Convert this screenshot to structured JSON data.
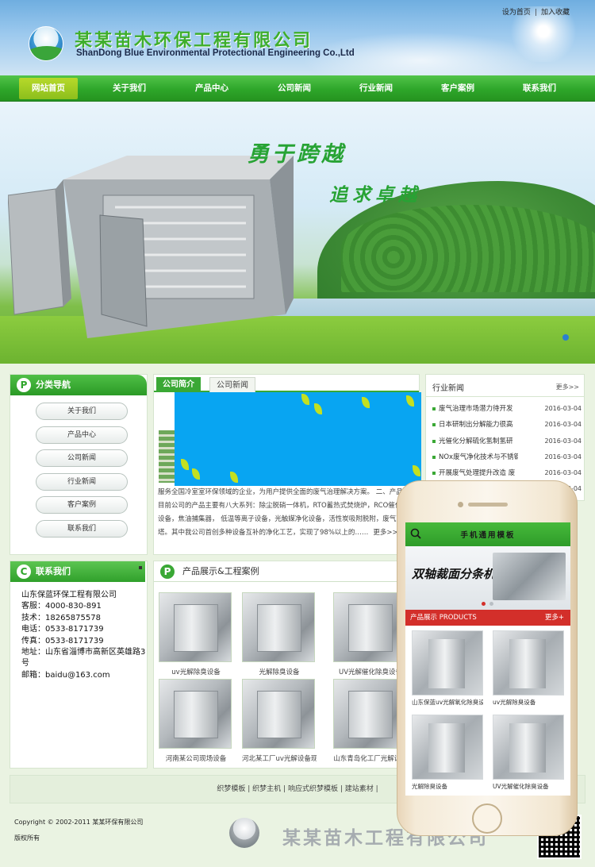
{
  "header": {
    "logo_cn": "某某苗木环保工程有限公司",
    "logo_en": "ShanDong Blue Environmental Protectional Engineering Co.,Ltd",
    "top_links": [
      "设为首页",
      "加入收藏"
    ],
    "top_links_sep": "|"
  },
  "nav": {
    "items": [
      "网站首页",
      "关于我们",
      "产品中心",
      "公司新闻",
      "行业新闻",
      "客户案例",
      "联系我们"
    ],
    "active_color": "#9ccb22",
    "bar_color": "#2ea62a"
  },
  "banner": {
    "slogan1": "勇于跨越",
    "slogan2": "追求卓越"
  },
  "category": {
    "badge": "P",
    "title": "分类导航",
    "items": [
      "关于我们",
      "产品中心",
      "公司新闻",
      "行业新闻",
      "客户案例",
      "联系我们"
    ]
  },
  "intro": {
    "tabs": [
      "公司简介",
      "公司新闻"
    ],
    "text": "服务全国冷室室环保领域的企业，为用户提供全面的废气治理解决方案。 二、产品简介 目前公司的产品主要有八大系列：除尘脱硝一体机，RTO蓄热式焚烧炉，RCO催化氧化设备，焦油捕集器， 低温等离子设备，光触媒净化设备，活性炭吸附脱附，废气净化塔。其中我公司首创多种设备互补的净化工艺，实现了98%以上的……",
    "more": "更多>>"
  },
  "industry_news": {
    "title": "行业新闻",
    "more": "更多>>",
    "items": [
      {
        "title": "废气治理市场潜力待开发",
        "date": "2016-03-04"
      },
      {
        "title": "日本研制出分解能力很高",
        "date": "2016-03-04"
      },
      {
        "title": "光催化分解硫化氢制氢研",
        "date": "2016-03-04"
      },
      {
        "title": "NOx废气净化技术与不锈钢",
        "date": "2016-03-04"
      },
      {
        "title": "开展废气处理提升改造 废",
        "date": "2016-03-04"
      },
      {
        "title": "",
        "date": "2016-03-04"
      },
      {
        "title": "",
        "date": "2016-03-04"
      }
    ]
  },
  "contact": {
    "badge": "C",
    "title": "联系我们",
    "lines": [
      "山东保蓝环保工程有限公司",
      "客服：4000-830-891",
      "技术：18265875578",
      "电话：0533-8171739",
      "传真：0533-8171739",
      "地址：山东省淄博市高新区英雄路3号",
      "邮箱：baidu@163.com"
    ]
  },
  "products": {
    "badge": "P",
    "title": "产品展示&工程案例",
    "items": [
      "uv光解除臭设备",
      "光解除臭设备",
      "UV光解催化除臭设备",
      "河南某公司现场设备",
      "河北某工厂uv光解设备现场",
      "山东青岛化工厂光解设备"
    ]
  },
  "footer": {
    "links": [
      "织梦模板",
      "织梦主机",
      "响应式织梦模板",
      "建站素材"
    ],
    "sep": "|",
    "copyright": "Copyright © 2002-2011 某某环保有限公司",
    "rights": "版权所有",
    "logo_text": "某某苗木工程有限公司"
  },
  "mobile": {
    "title": "手机通用模板",
    "banner_text": "双轴裁面分条机",
    "products_label": "产品展示",
    "products_label_en": "PRODUCTS",
    "more": "更多+",
    "items": [
      "山东保蓝uv光解氧化除臭设备",
      "uv光解除臭设备",
      "光解除臭设备",
      "UV光解催化除臭设备"
    ],
    "bar_color": "#d32f2a"
  }
}
